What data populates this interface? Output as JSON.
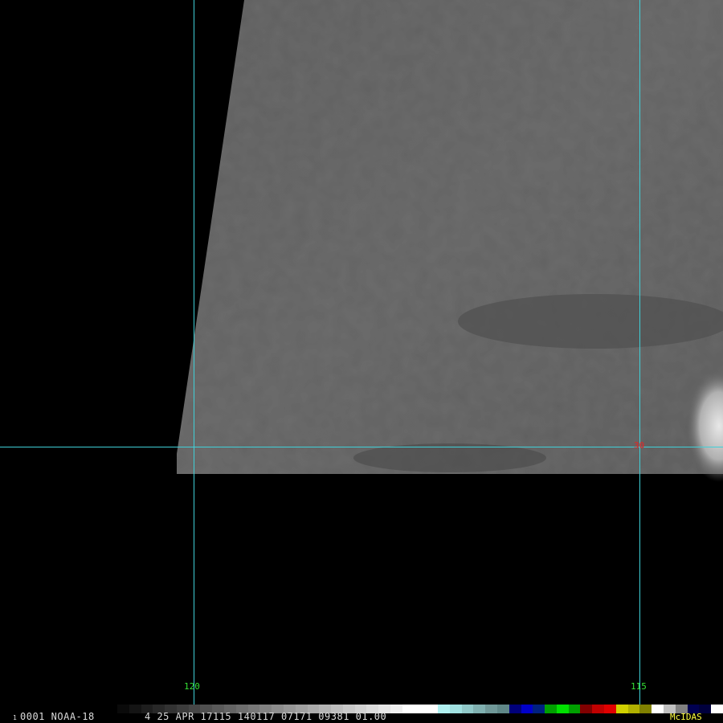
{
  "image": {
    "satellite": "NOAA-18",
    "frame_number": "0001",
    "frame_indicator": "1",
    "info_line": "4 25 APR 17115 140117 07171 09381 01.00",
    "branding": "McIDAS"
  },
  "grid": {
    "line_color": "#3fd0d8",
    "longitude_labels": [
      "120",
      "115"
    ],
    "latitude_labels": [
      "30"
    ]
  },
  "colorbar": {
    "segments": [
      "#0a0a0a",
      "#141414",
      "#1e1e1e",
      "#282828",
      "#323232",
      "#3c3c3c",
      "#464646",
      "#505050",
      "#5a5a5a",
      "#646464",
      "#6e6e6e",
      "#787878",
      "#828282",
      "#8c8c8c",
      "#969696",
      "#a0a0a0",
      "#aaaaaa",
      "#b4b4b4",
      "#bebebe",
      "#c8c8c8",
      "#d2d2d2",
      "#dcdcdc",
      "#e6e6e6",
      "#f0f0f0",
      "#ffffff",
      "#ffffff",
      "#ffffff",
      "#b0f0f0",
      "#a0e0e0",
      "#90c8c8",
      "#80b0b0",
      "#709898",
      "#608888",
      "#00007a",
      "#0000c8",
      "#002080",
      "#00a000",
      "#00e000",
      "#00a000",
      "#800000",
      "#c00000",
      "#e00000",
      "#d0d000",
      "#b0b000",
      "#808000",
      "#ffffff",
      "#c0c0c0",
      "#808080",
      "#000050",
      "#00003c",
      "#ffffff"
    ]
  }
}
